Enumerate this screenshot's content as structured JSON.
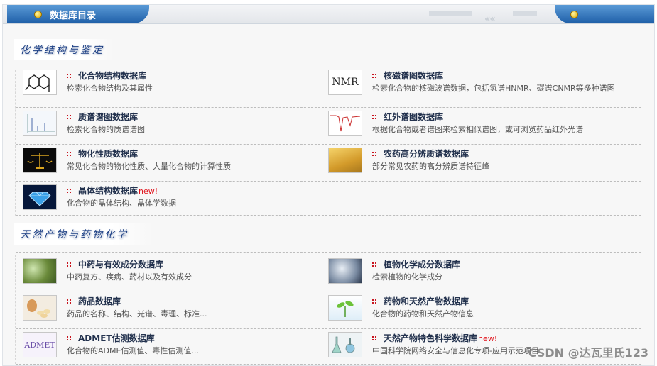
{
  "header": {
    "title": "数据库目录"
  },
  "sections": [
    {
      "title": "化学结构与鉴定",
      "entries": [
        {
          "name": "化合物结构数据库",
          "desc": "检索化合物结构及其属性",
          "thumb": "molecule-structure-thumbnail"
        },
        {
          "name": "核磁谱图数据库",
          "desc": "检索化合物的核磁波谱数据，包括氢谱HNMR、碳谱CNMR等多种谱图",
          "thumb": "nmr-thumbnail",
          "thumb_text": "NMR"
        },
        {
          "name": "质谱谱图数据库",
          "desc": "检索化合物的质谱谱图",
          "thumb": "mass-spectrum-thumbnail"
        },
        {
          "name": "红外谱图数据库",
          "desc": "根据化合物或者谱图来检索相似谱图，或可浏览药品红外光谱",
          "thumb": "ir-spectrum-thumbnail"
        },
        {
          "name": "物化性质数据库",
          "desc": "常见化合物的物化性质、大量化合物的计算性质",
          "thumb": "scale-thumbnail"
        },
        {
          "name": "农药高分辨质谱数据库",
          "desc": "部分常见农药的高分辨质谱特征峰",
          "thumb": "wheat-field-thumbnail"
        },
        {
          "name": "晶体结构数据库",
          "new": "new!",
          "desc": "化合物的晶体结构、晶体学数据",
          "thumb": "diamond-thumbnail"
        }
      ]
    },
    {
      "title": "天然产物与药物化学",
      "entries": [
        {
          "name": "中药与有效成分数据库",
          "desc": "中药复方、疾病、药材以及有效成分",
          "thumb": "herbs-thumbnail"
        },
        {
          "name": "植物化学成分数据库",
          "desc": "检索植物的化学成分",
          "thumb": "plant-thumbnail"
        },
        {
          "name": "药品数据库",
          "desc": "药品的名称、结构、光谱、毒理、标准...",
          "thumb": "pills-thumbnail"
        },
        {
          "name": "药物和天然产物数据库",
          "desc": "化合物的药物和天然产物信息",
          "thumb": "sprout-thumbnail"
        },
        {
          "name": "ADMET估测数据库",
          "desc": "化合物的ADME估测值、毒性估测值...",
          "thumb": "admet-thumbnail",
          "thumb_text": "ADMET"
        },
        {
          "name": "天然产物特色科学数据库",
          "new": "new!",
          "desc": "中国科学院网络安全与信息化专项-应用示范项目",
          "thumb": "flasks-thumbnail"
        }
      ]
    }
  ],
  "watermark": "CSDN @达瓦里氏123"
}
